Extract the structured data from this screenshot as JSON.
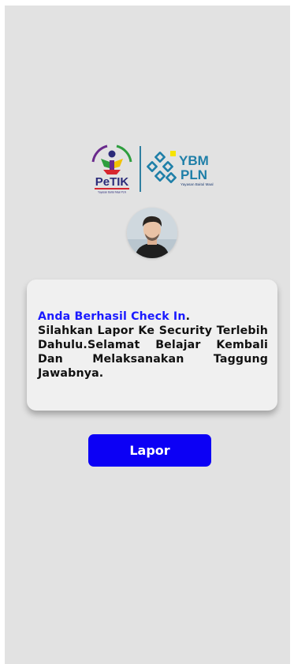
{
  "logos": {
    "petik": {
      "wordmark": "PeTIK",
      "ring_text": "Pesantren Teknologi Informasi dan Komunikasi",
      "tagline": "Yayasan Baitul Maal PLN",
      "colors": {
        "dark": "#2b2b7a",
        "red": "#d7262f",
        "green": "#2e9e3e",
        "yellow": "#f2c200",
        "purple": "#6a2a8c"
      }
    },
    "ybm": {
      "title_line1": "YBM",
      "title_line2": "PLN",
      "subtitle": "Yayasan Baitul Maal",
      "colors": {
        "teal": "#1f7fa8",
        "yellow": "#f6e400",
        "navy": "#1e3c72"
      }
    }
  },
  "avatar": {
    "icon": "user-avatar-photo",
    "colors": {
      "hair": "#2a241f",
      "skin": "#e9c3a6",
      "shirt": "#1f1f1f",
      "bg": "#cfd8de"
    }
  },
  "message": {
    "highlight": "Anda Berhasil Check In",
    "highlight_end": ".",
    "body": "Silahkan Lapor Ke Security Terlebih Dahulu.Selamat Belajar Kembali Dan Melaksanakan Taggung Jawabnya.",
    "highlight_color": "#1a1aff"
  },
  "actions": {
    "lapor_label": "Lapor",
    "button_color": "#0c00f5"
  }
}
